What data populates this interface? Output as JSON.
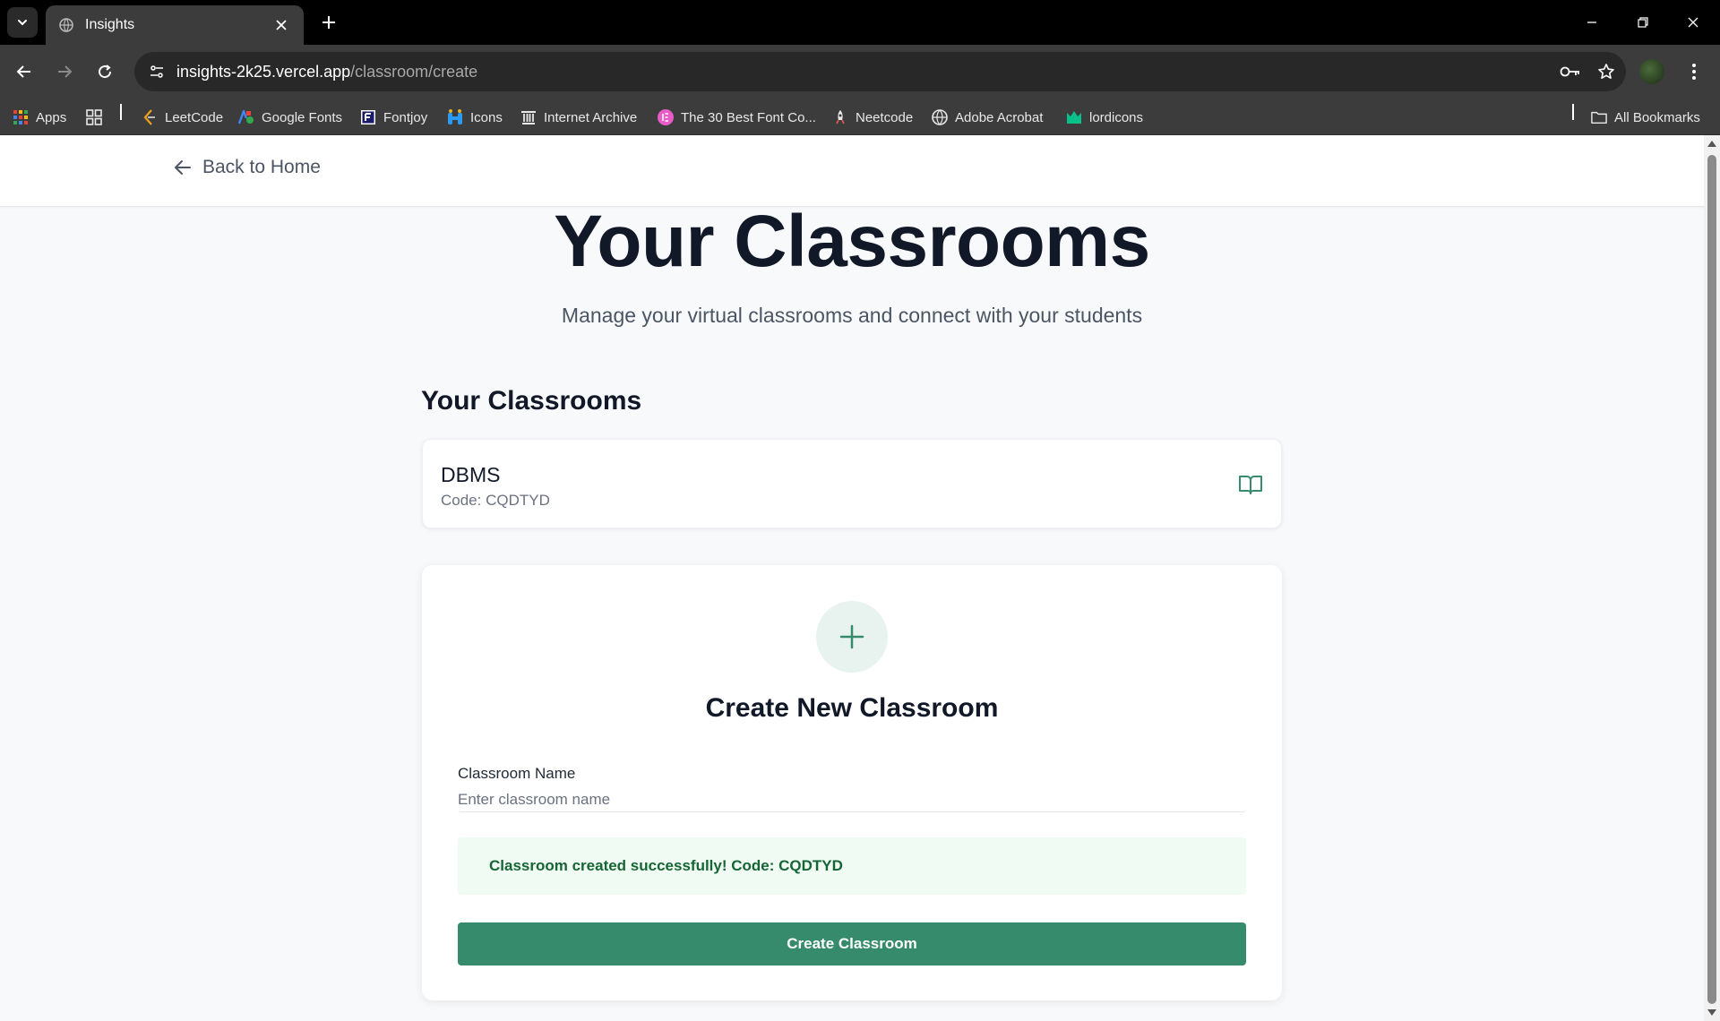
{
  "browser": {
    "tab_title": "Insights",
    "url_host": "insights-2k25.vercel.app",
    "url_path": "/classroom/create",
    "bookmarks": [
      {
        "label": "Apps",
        "icon": "apps-grid-icon"
      },
      {
        "label": "",
        "icon": "tab-groups-icon"
      },
      {
        "label": "LeetCode",
        "icon": "leetcode-icon"
      },
      {
        "label": "Google Fonts",
        "icon": "google-fonts-icon"
      },
      {
        "label": "Fontjoy",
        "icon": "fontjoy-icon"
      },
      {
        "label": "Icons",
        "icon": "icons8-icon"
      },
      {
        "label": "Internet Archive",
        "icon": "internet-archive-icon"
      },
      {
        "label": "The 30 Best Font Co...",
        "icon": "font-collection-icon"
      },
      {
        "label": "Neetcode",
        "icon": "neetcode-icon"
      },
      {
        "label": "Adobe Acrobat",
        "icon": "adobe-acrobat-icon"
      },
      {
        "label": "lordicons",
        "icon": "lordicons-icon"
      }
    ],
    "all_bookmarks_label": "All Bookmarks"
  },
  "page": {
    "back_label": "Back to Home",
    "hero_title": "Your Classrooms",
    "hero_subtitle": "Manage your virtual classrooms and connect with your students",
    "section_title": "Your Classrooms",
    "classrooms": [
      {
        "name": "DBMS",
        "code": "Code: CQDTYD",
        "icon": "book-open-icon"
      }
    ],
    "create": {
      "title": "Create New Classroom",
      "name_label": "Classroom Name",
      "name_placeholder": "Enter classroom name",
      "name_value": "",
      "success_message": "Classroom created successfully! Code: CQDTYD",
      "button_label": "Create Classroom"
    }
  },
  "colors": {
    "accent": "#358b6c",
    "success_bg": "#f0fbf4",
    "success_text": "#166534"
  }
}
